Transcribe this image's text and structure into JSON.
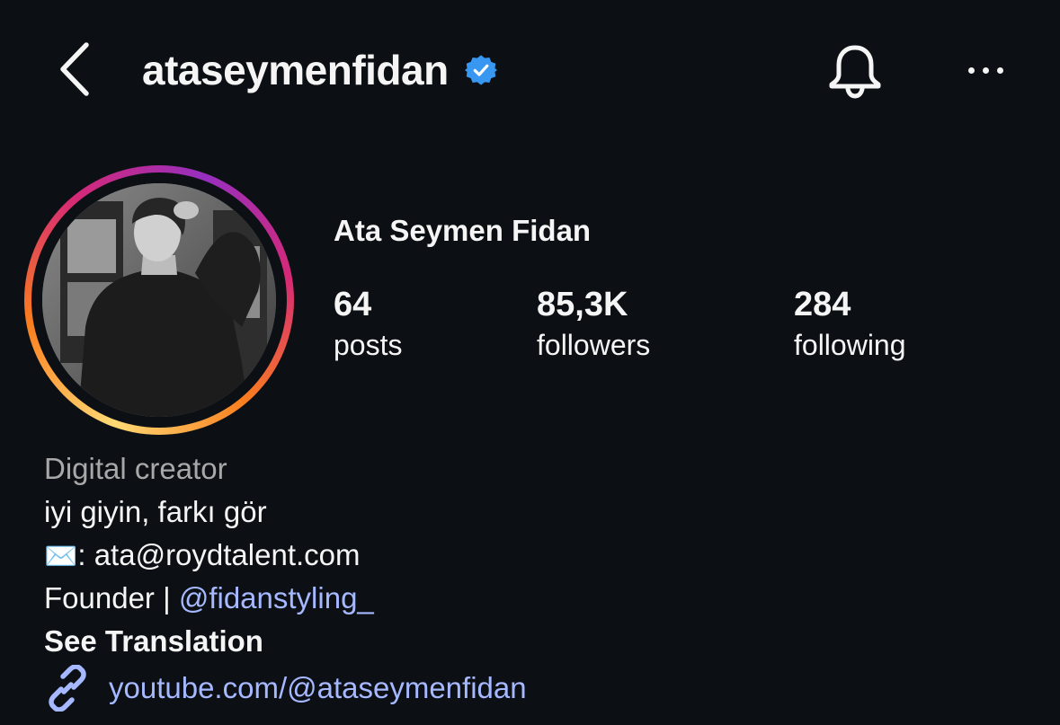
{
  "header": {
    "username": "ataseymenfidan",
    "verified_icon": "verified-badge-icon",
    "back_icon": "chevron-left-icon",
    "bell_icon": "bell-icon",
    "more_icon": "more-horizontal-icon"
  },
  "profile": {
    "full_name": "Ata Seymen Fidan",
    "avatar_alt": "profile-photo"
  },
  "stats": {
    "posts": {
      "count": "64",
      "label": "posts"
    },
    "followers": {
      "count": "85,3K",
      "label": "followers"
    },
    "following": {
      "count": "284",
      "label": "following"
    }
  },
  "bio": {
    "category": "Digital creator",
    "line1": "iyi giyin, farkı gör",
    "email_emoji": "✉️",
    "email_text": ": ata@roydtalent.com",
    "founder_prefix": "Founder | ",
    "founder_mention": "@fidanstyling_",
    "see_translation": "See Translation",
    "link_icon": "link-icon",
    "link": "youtube.com/@ataseymenfidan"
  },
  "colors": {
    "background": "#0c1014",
    "text": "#f5f5f5",
    "secondary_text": "#a8a8a8",
    "link": "#a6b8ff",
    "verified": "#3897f0"
  }
}
